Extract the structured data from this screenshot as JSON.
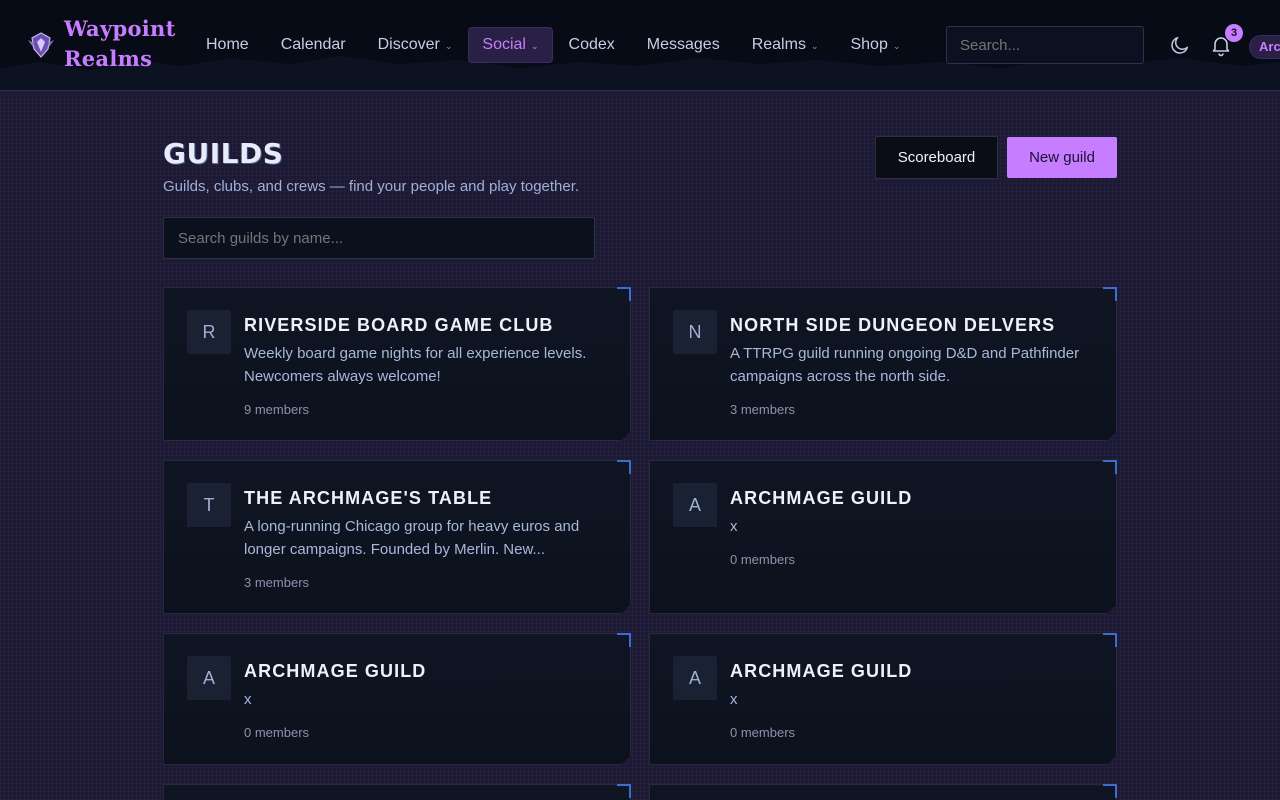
{
  "brand": {
    "line1": "Waypoint",
    "line2": "Realms"
  },
  "nav": [
    {
      "label": "Home",
      "dropdown": false,
      "active": false
    },
    {
      "label": "Calendar",
      "dropdown": false,
      "active": false
    },
    {
      "label": "Discover",
      "dropdown": true,
      "active": false
    },
    {
      "label": "Social",
      "dropdown": true,
      "active": true
    },
    {
      "label": "Codex",
      "dropdown": false,
      "active": false
    },
    {
      "label": "Messages",
      "dropdown": false,
      "active": false
    },
    {
      "label": "Realms",
      "dropdown": true,
      "active": false
    },
    {
      "label": "Shop",
      "dropdown": true,
      "active": false
    }
  ],
  "header": {
    "search_placeholder": "Search...",
    "notification_count": "3",
    "user_label": "Arc"
  },
  "page": {
    "title": "GUILDS",
    "subtitle": "Guilds, clubs, and crews — find your people and play together.",
    "scoreboard_label": "Scoreboard",
    "new_guild_label": "New guild",
    "search_placeholder": "Search guilds by name..."
  },
  "guilds": [
    {
      "initial": "R",
      "name": "RIVERSIDE BOARD GAME CLUB",
      "description": "Weekly board game nights for all experience levels. Newcomers always welcome!",
      "members": "9 members"
    },
    {
      "initial": "N",
      "name": "NORTH SIDE DUNGEON DELVERS",
      "description": "A TTRPG guild running ongoing D&D and Pathfinder campaigns across the north side.",
      "members": "3 members"
    },
    {
      "initial": "T",
      "name": "THE ARCHMAGE'S TABLE",
      "description": "A long-running Chicago group for heavy euros and longer campaigns. Founded by Merlin. New...",
      "members": "3 members"
    },
    {
      "initial": "A",
      "name": "ARCHMAGE GUILD",
      "description": "x",
      "members": "0 members"
    },
    {
      "initial": "A",
      "name": "ARCHMAGE GUILD",
      "description": "x",
      "members": "0 members"
    },
    {
      "initial": "A",
      "name": "ARCHMAGE GUILD",
      "description": "x",
      "members": "0 members"
    }
  ],
  "colors": {
    "accent": "#c77dff",
    "header_bg": "#070b16",
    "page_bg": "#1d1935",
    "card_bg": "#0f1523",
    "card_corner": "#3a6fd0"
  }
}
